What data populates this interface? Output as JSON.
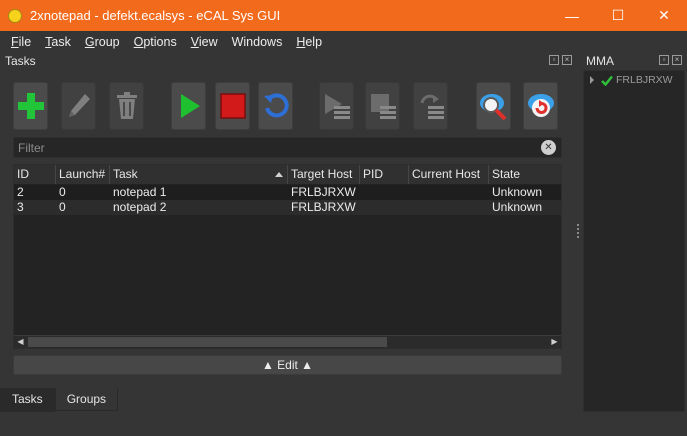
{
  "window": {
    "title": "2xnotepad - defekt.ecalsys - eCAL Sys GUI",
    "minimize": "—",
    "maximize": "☐",
    "close": "✕"
  },
  "menu": {
    "items": [
      {
        "first": "F",
        "rest": "ile"
      },
      {
        "first": "T",
        "rest": "ask"
      },
      {
        "first": "G",
        "rest": "roup"
      },
      {
        "first": "O",
        "rest": "ptions"
      },
      {
        "first": "V",
        "rest": "iew"
      },
      {
        "first": "",
        "rest": "Windows"
      },
      {
        "first": "H",
        "rest": "elp"
      }
    ]
  },
  "tasks_dock": {
    "title": "Tasks",
    "toolbar": {
      "icons": [
        "add-icon",
        "edit-icon",
        "delete-icon",
        "start-icon",
        "stop-icon",
        "restart-icon",
        "start-all-icon",
        "stop-all-icon",
        "restart-all-icon",
        "search-hosts-icon",
        "refresh-icon"
      ]
    },
    "filter": {
      "placeholder": "Filter",
      "value": ""
    },
    "table": {
      "columns": [
        "ID",
        "Launch#",
        "Task",
        "Target Host",
        "PID",
        "Current Host",
        "State"
      ],
      "rows": [
        [
          "2",
          "0",
          "notepad 1",
          "FRLBJRXW",
          "",
          "",
          "Unknown"
        ],
        [
          "3",
          "0",
          "notepad 2",
          "FRLBJRXW",
          "",
          "",
          "Unknown"
        ]
      ]
    },
    "edit_button": "▲ Edit ▲"
  },
  "bottom_tabs": [
    "Tasks",
    "Groups"
  ],
  "mma_dock": {
    "title": "MMA",
    "hosts": [
      {
        "name": "FRLBJRXW",
        "status": "ok"
      }
    ]
  },
  "colors": {
    "title_bar": "#f26a1c",
    "add_green": "#22c53a",
    "start_green": "#1fc02f",
    "stop_red": "#d21a1a",
    "restart_blue": "#2d6fd6",
    "status_ok": "#2fbf3a"
  }
}
